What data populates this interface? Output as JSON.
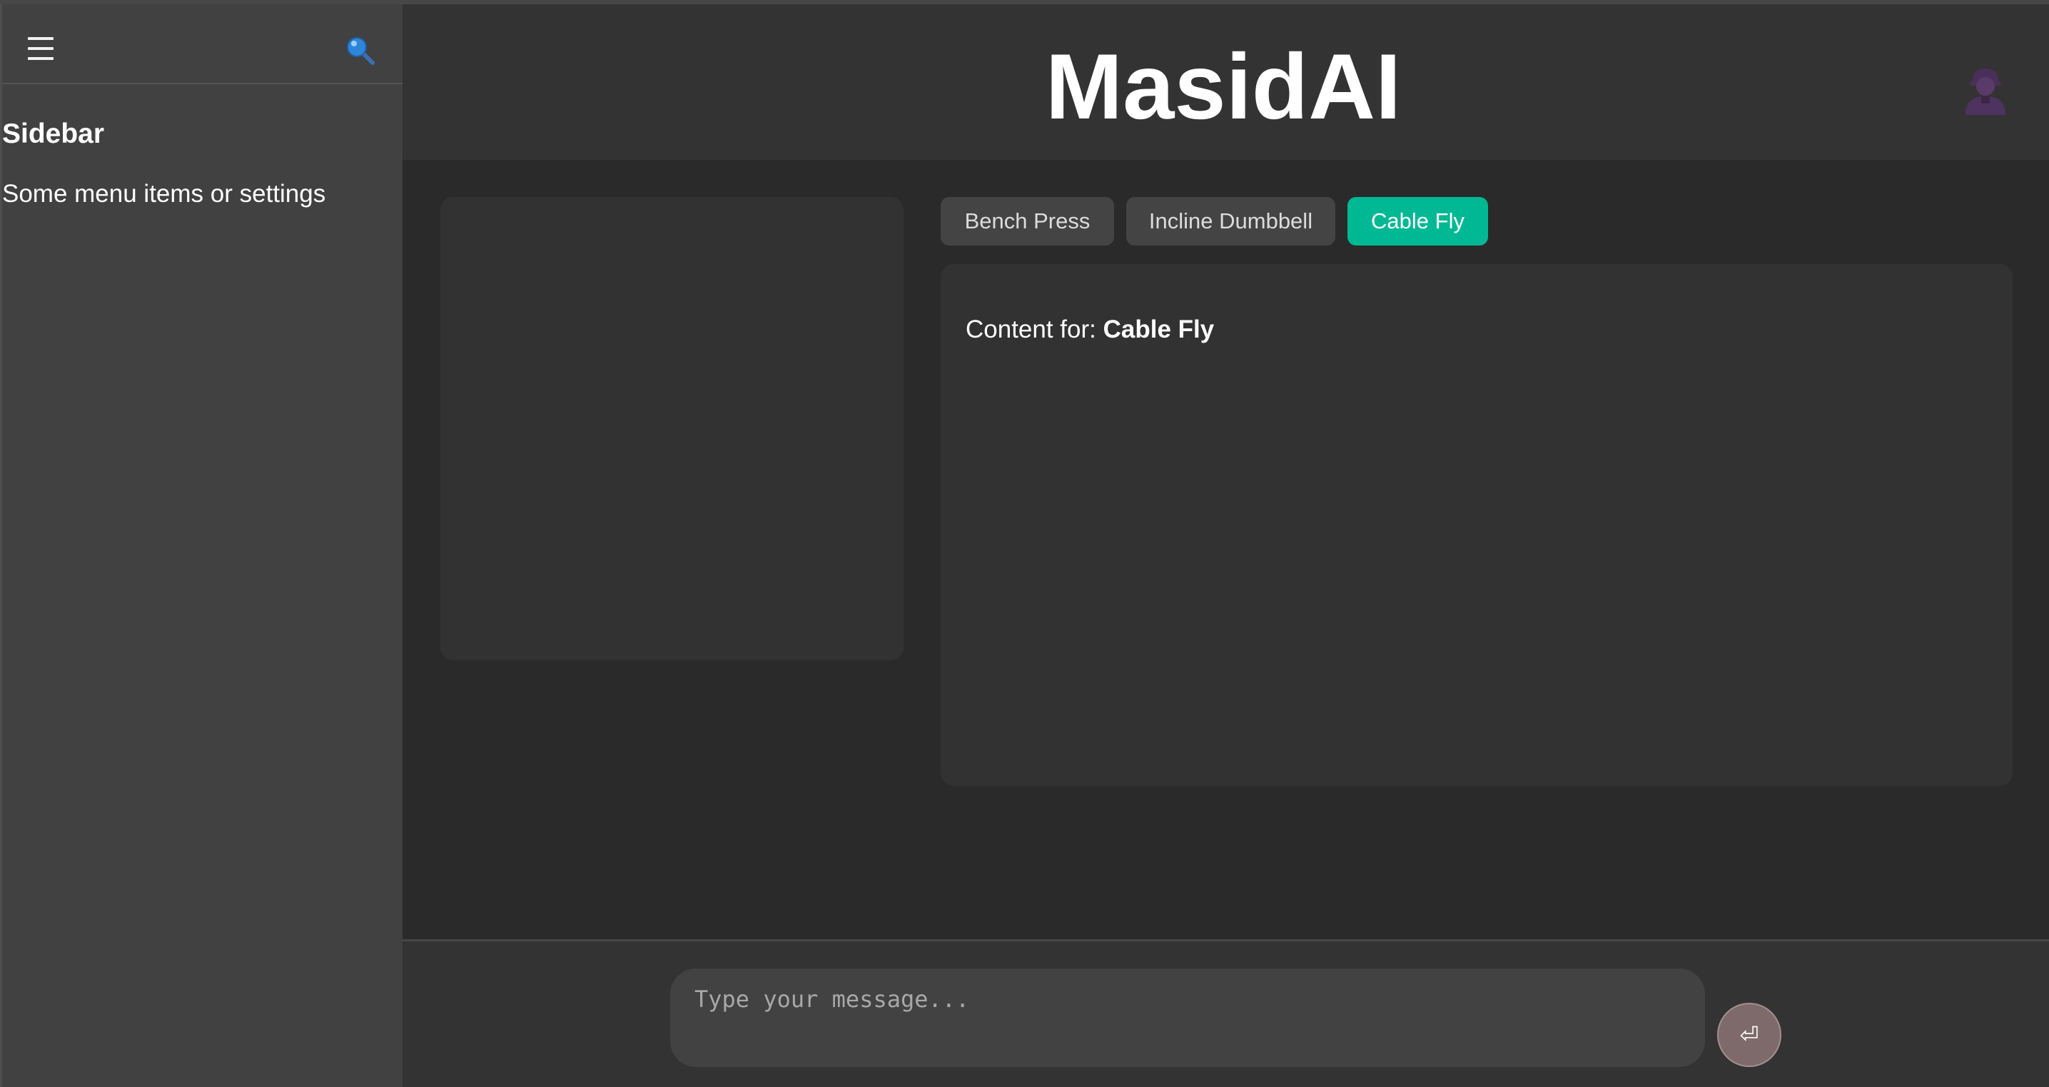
{
  "app": {
    "title": "MasidAI"
  },
  "sidebar": {
    "title": "Sidebar",
    "text": "Some menu items or settings",
    "menu_icon": "hamburger-menu-icon",
    "search_icon": "magnifying-glass-icon"
  },
  "header": {
    "avatar_icon": "user-avatar-icon"
  },
  "tabs": [
    {
      "label": "Bench Press",
      "active": false
    },
    {
      "label": "Incline Dumbbell",
      "active": false
    },
    {
      "label": "Cable Fly",
      "active": true
    }
  ],
  "content": {
    "prefix": "Content for:",
    "selected": "Cable Fly"
  },
  "chat": {
    "placeholder": "Type your message...",
    "send_glyph": "⏎",
    "send_icon": "return-arrow-icon"
  },
  "colors": {
    "accent": "#00b894",
    "background": "#2a2a2a",
    "panel": "#323232",
    "sidebar": "#414141",
    "avatar": "#5a3a6a"
  }
}
